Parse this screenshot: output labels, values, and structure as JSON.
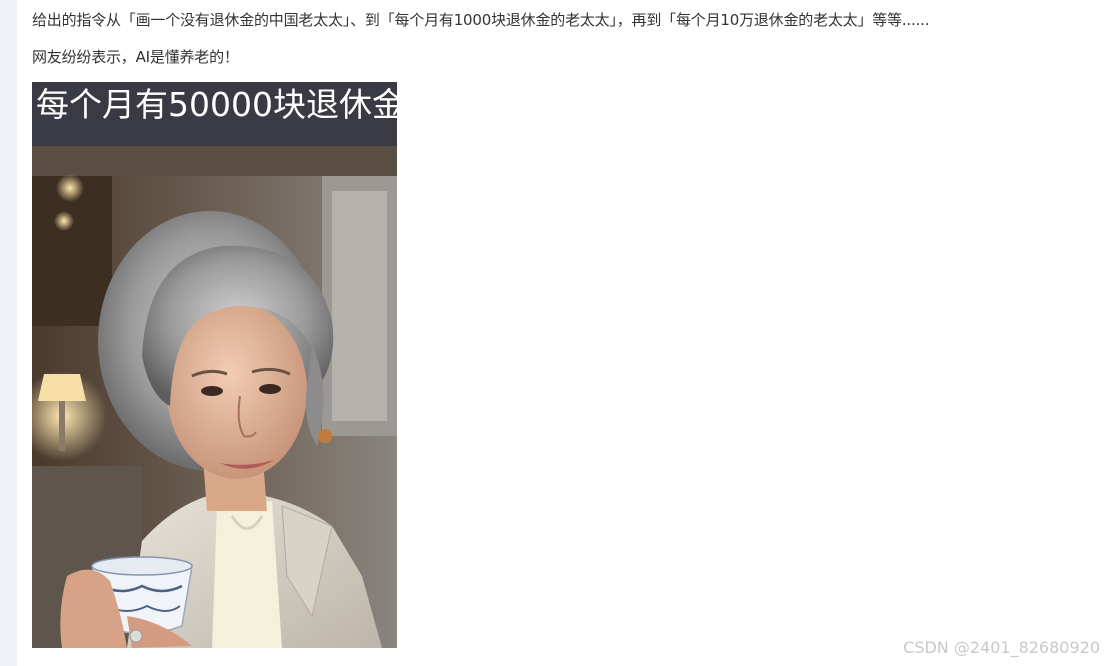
{
  "article": {
    "paragraph_1": "给出的指令从「画一个没有退休金的中国老太太」、到「每个月有1000块退休金的老太太」，再到「每个月10万退休金的老太太」等等......",
    "paragraph_2": "网友纷纷表示，AI是懂养老的！"
  },
  "figure": {
    "caption": "每个月有50000块退休金"
  },
  "watermark": {
    "text": "CSDN @2401_82680920"
  },
  "colors": {
    "rail": "#eef1f6",
    "caption_bar": "#3a3a44",
    "body_text": "#333333",
    "watermark": "#c8c8c8"
  }
}
